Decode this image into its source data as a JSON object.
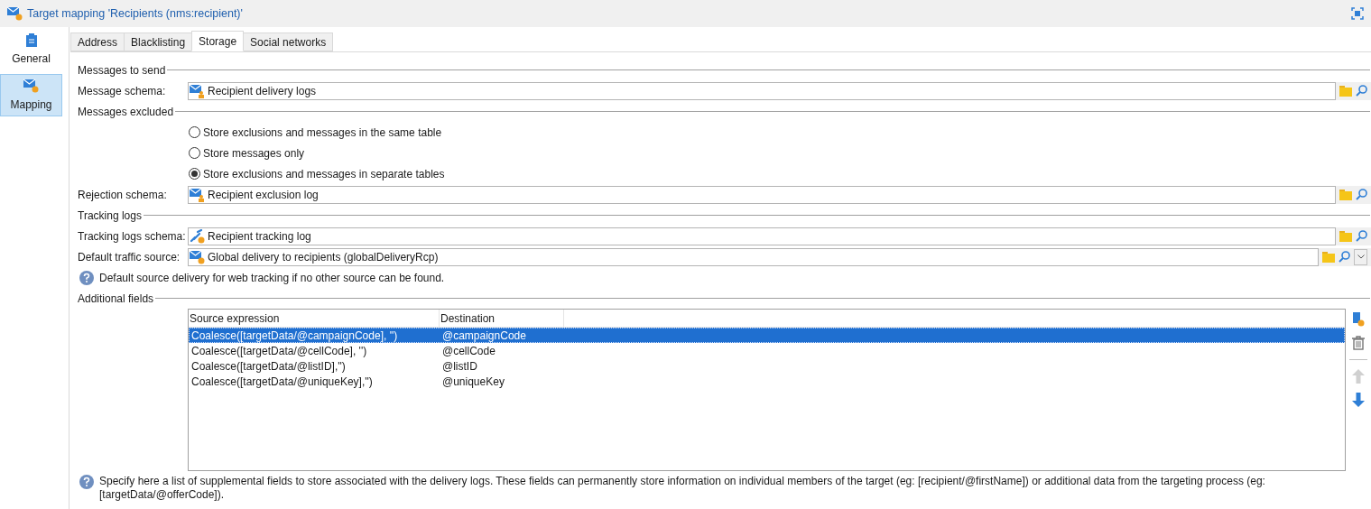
{
  "window": {
    "title": "Target mapping 'Recipients (nms:recipient)'"
  },
  "sidebar": {
    "items": [
      {
        "label": "General",
        "selected": false
      },
      {
        "label": "Mapping",
        "selected": true
      }
    ]
  },
  "tabs": [
    {
      "label": "Address",
      "selected": false
    },
    {
      "label": "Blacklisting",
      "selected": false
    },
    {
      "label": "Storage",
      "selected": true
    },
    {
      "label": "Social networks",
      "selected": false
    }
  ],
  "messages_to_send": {
    "heading": "Messages to send",
    "message_schema": {
      "label": "Message schema:",
      "value": "Recipient delivery logs"
    }
  },
  "messages_excluded": {
    "heading": "Messages excluded",
    "options": [
      {
        "label": "Store exclusions and messages in the same table",
        "selected": false
      },
      {
        "label": "Store messages only",
        "selected": false
      },
      {
        "label": "Store exclusions and messages in separate tables",
        "selected": true
      }
    ],
    "rejection_schema": {
      "label": "Rejection schema:",
      "value": "Recipient exclusion log"
    }
  },
  "tracking_logs": {
    "heading": "Tracking logs",
    "tracking_logs_schema": {
      "label": "Tracking logs schema:",
      "value": "Recipient tracking log"
    },
    "default_traffic_source": {
      "label": "Default traffic source:",
      "value": "Global delivery to recipients (globalDeliveryRcp)"
    },
    "hint": "Default source delivery for web tracking if no other source can be found."
  },
  "additional_fields": {
    "heading": "Additional fields",
    "table": {
      "columns": [
        "Source expression",
        "Destination"
      ],
      "rows": [
        {
          "cells": [
            "Coalesce([targetData/@campaignCode], '')",
            "@campaignCode"
          ],
          "selected": true
        },
        {
          "cells": [
            "Coalesce([targetData/@cellCode], '')",
            "@cellCode"
          ],
          "selected": false
        },
        {
          "cells": [
            "Coalesce([targetData/@listID],'')",
            "@listID"
          ],
          "selected": false
        },
        {
          "cells": [
            "Coalesce([targetData/@uniqueKey],'')",
            "@uniqueKey"
          ],
          "selected": false
        }
      ]
    },
    "help": "Specify here a list of supplemental fields to store associated with the delivery logs. These fields can permanently store information on individual members of the target (eg: [recipient/@firstName]) or additional data from the targeting process (eg: [targetData/@offerCode])."
  }
}
